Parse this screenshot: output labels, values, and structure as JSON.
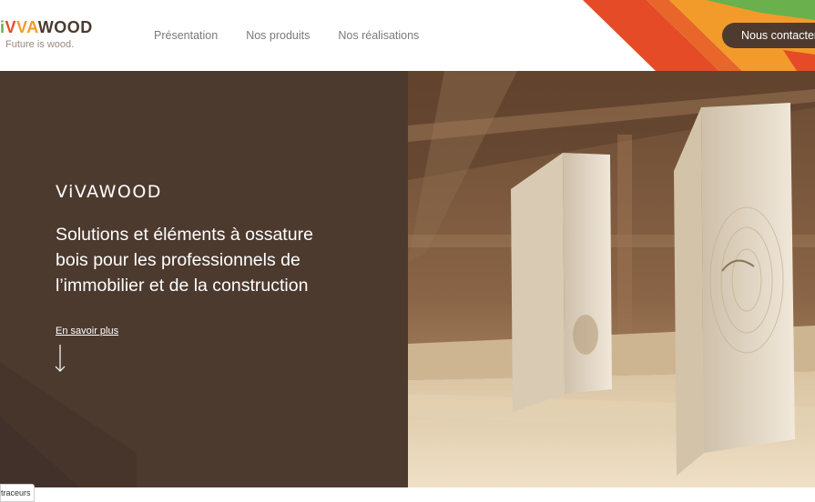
{
  "header": {
    "logo": {
      "v": "V",
      "i": "i",
      "va": "VA",
      "wood": "WOOD",
      "tagline": "Future is wood."
    },
    "nav": [
      "Présentation",
      "Nos produits",
      "Nos réalisations"
    ],
    "cta_label": "Nous contacter"
  },
  "hero": {
    "brand": "ViVAWOOD",
    "title": "Solutions et éléments à ossature bois pour les professionnels de l’immobilier et de la construction",
    "learn_more": "En savoir plus",
    "photo_icon": "wood-beams-photo"
  },
  "footer": {
    "tracker_label": "traceurs"
  },
  "colors": {
    "brown": "#4d3a2f",
    "green": "#6ab04c",
    "red": "#e54b27",
    "orange": "#f39b2a"
  },
  "icons": {
    "arrow": "arrow-down-icon"
  }
}
